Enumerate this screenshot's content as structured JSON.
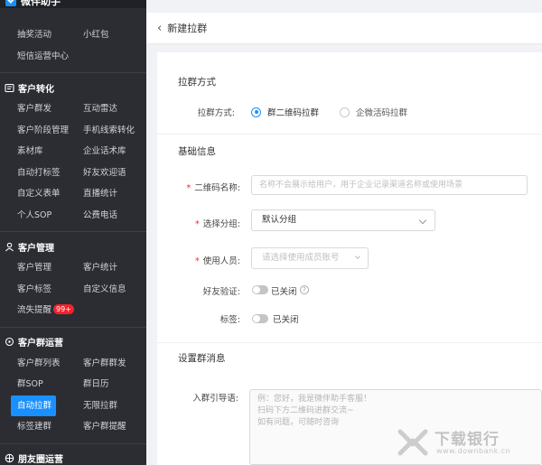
{
  "app": {
    "brand": "微伴助手"
  },
  "sidebar": {
    "top_items": [
      {
        "label": "抽奖活动"
      },
      {
        "label": "小红包"
      },
      {
        "label": "短信运营中心"
      }
    ],
    "sections": [
      {
        "title": "客户转化",
        "icon": "people-icon",
        "items": [
          {
            "label": "客户群发"
          },
          {
            "label": "互动雷达"
          },
          {
            "label": "客户阶段管理"
          },
          {
            "label": "手机线索转化"
          },
          {
            "label": "素材库"
          },
          {
            "label": "企业话术库"
          },
          {
            "label": "自动打标签"
          },
          {
            "label": "好友欢迎语"
          },
          {
            "label": "自定义表单"
          },
          {
            "label": "直播统计"
          },
          {
            "label": "个人SOP"
          },
          {
            "label": "公费电话"
          }
        ]
      },
      {
        "title": "客户管理",
        "icon": "user-icon",
        "items": [
          {
            "label": "客户管理"
          },
          {
            "label": "客户统计"
          },
          {
            "label": "客户标签"
          },
          {
            "label": "自定义信息"
          },
          {
            "label": "流失提醒",
            "badge": "99+"
          }
        ]
      },
      {
        "title": "客户群运营",
        "icon": "group-icon",
        "items": [
          {
            "label": "客户群列表"
          },
          {
            "label": "客户群群发"
          },
          {
            "label": "群SOP"
          },
          {
            "label": "群日历"
          },
          {
            "label": "自动拉群",
            "active": true
          },
          {
            "label": "无限拉群"
          },
          {
            "label": "标签建群"
          },
          {
            "label": "客户群提醒"
          }
        ]
      },
      {
        "title": "朋友圈运营",
        "icon": "moments-icon",
        "items": []
      }
    ]
  },
  "header": {
    "back_icon": "chevron-left-icon",
    "title": "新建拉群"
  },
  "form": {
    "method_section": {
      "title": "拉群方式",
      "label": "拉群方式:",
      "options": [
        {
          "label": "群二维码拉群",
          "selected": true
        },
        {
          "label": "企微活码拉群",
          "selected": false
        }
      ]
    },
    "basic_section": {
      "title": "基础信息",
      "qrcode_name": {
        "label": "二维码名称:",
        "placeholder": "名称不会展示给用户，用于企业记录渠道名称或使用场景"
      },
      "group": {
        "label": "选择分组:",
        "value": "默认分组"
      },
      "members": {
        "label": "使用人员:",
        "placeholder": "请选择使用成员账号"
      },
      "verify": {
        "label": "好友验证:",
        "state": "已关闭"
      },
      "tags": {
        "label": "标签:",
        "state": "已关闭"
      }
    },
    "message_section": {
      "title": "设置群消息",
      "intro": {
        "label": "入群引导语:",
        "placeholder_lines": [
          "例：您好，我是微伴助手客服！",
          "扫码下方二维码进群交流~",
          "如有问题，可随时咨询"
        ]
      }
    }
  },
  "watermark": {
    "name": "下载银行",
    "url": "www.downbank.cn"
  },
  "colors": {
    "accent": "#1890ff",
    "sidebar_bg": "#2b2d33",
    "badge": "#f5222d"
  }
}
